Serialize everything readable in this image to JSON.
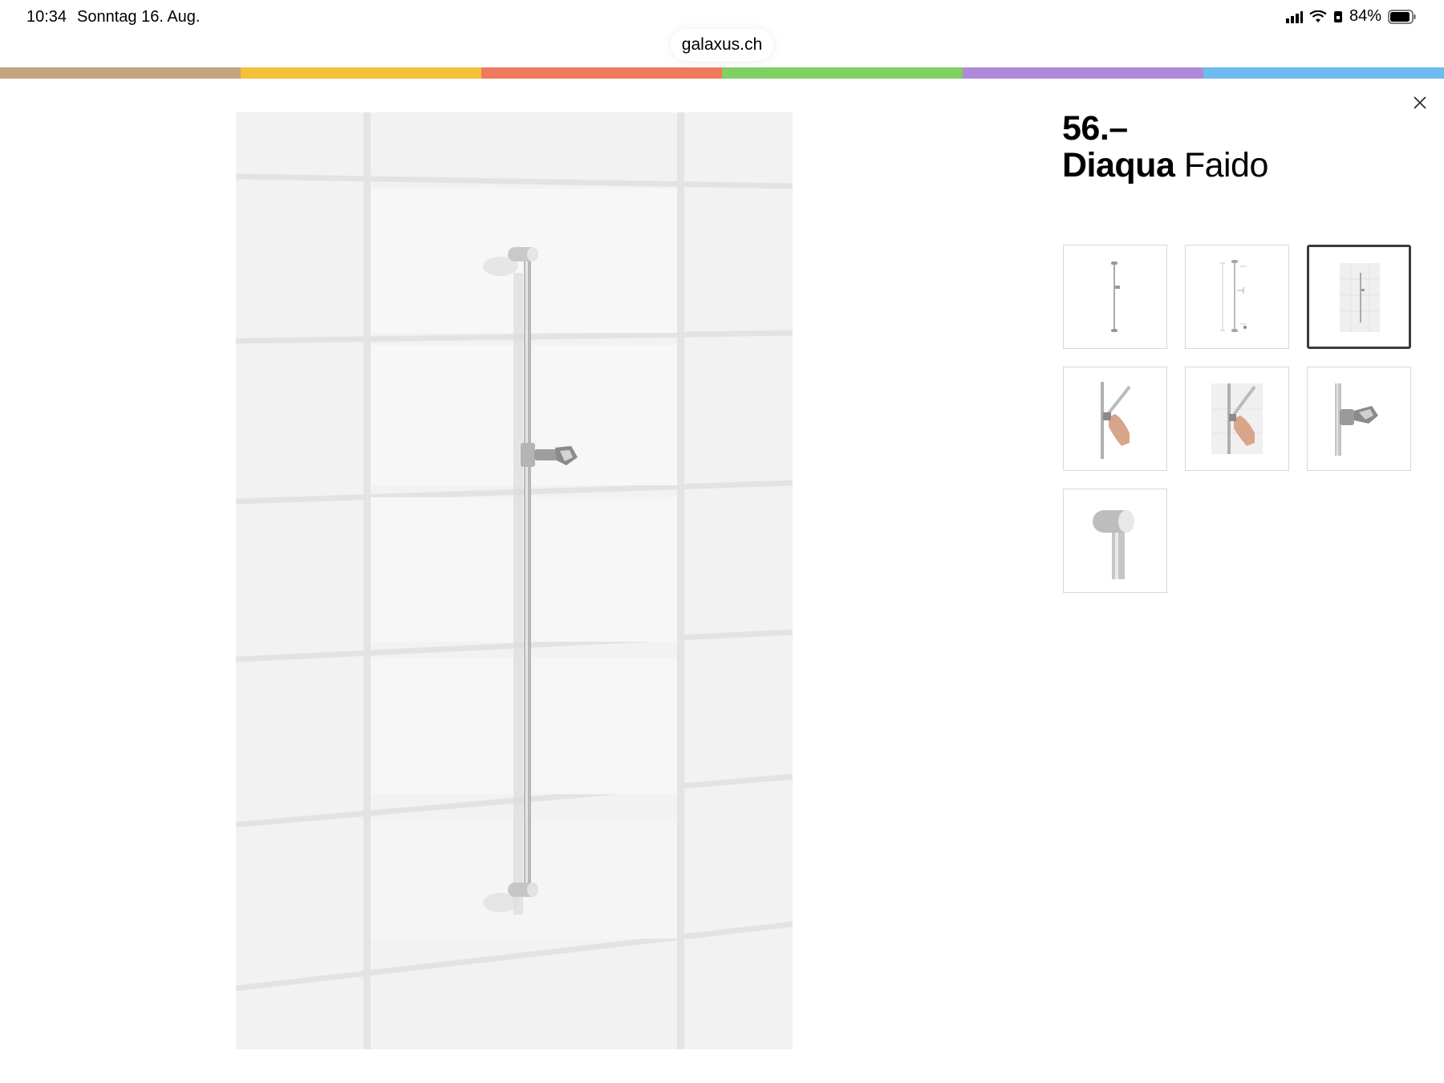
{
  "status_bar": {
    "time": "10:34",
    "date": "Sonntag 16. Aug.",
    "battery": "84%"
  },
  "browser": {
    "url": "galaxus.ch"
  },
  "color_strip": [
    "#c5a47e",
    "#f5bf3a",
    "#f07a5e",
    "#7fcf63",
    "#ae8ad8",
    "#6dbbef"
  ],
  "product": {
    "price": "56.–",
    "brand": "Diaqua",
    "name": "Faido"
  },
  "main_image": {
    "icon": "shower-rail-on-tiles"
  },
  "thumbnails": [
    {
      "icon": "shower-rail-front-view",
      "selected": false
    },
    {
      "icon": "shower-rail-dimension-drawing",
      "selected": false
    },
    {
      "icon": "shower-rail-on-tiles",
      "selected": true
    },
    {
      "icon": "hand-adjusting-shower-holder",
      "selected": false
    },
    {
      "icon": "hand-adjusting-shower-holder-tiles",
      "selected": false
    },
    {
      "icon": "shower-holder-closeup",
      "selected": false
    },
    {
      "icon": "rail-end-cap-closeup",
      "selected": false
    }
  ],
  "close_icon": "close-icon"
}
